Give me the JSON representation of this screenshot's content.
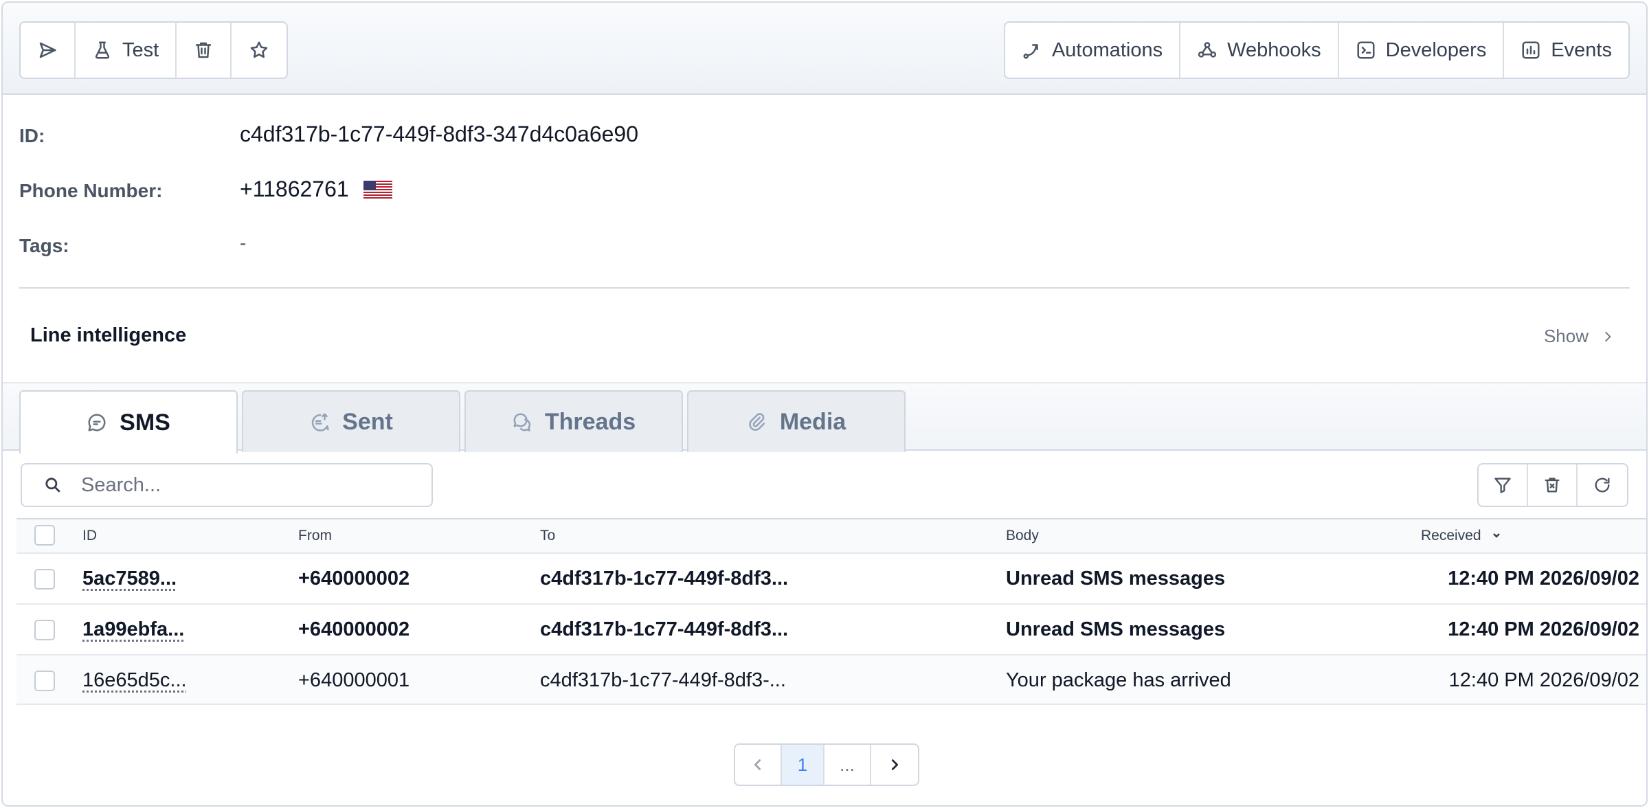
{
  "toolbar": {
    "left_buttons": [
      {
        "icon": "send-icon",
        "label": ""
      },
      {
        "icon": "flask-icon",
        "label": "Test"
      },
      {
        "icon": "trash-icon",
        "label": ""
      },
      {
        "icon": "star-icon",
        "label": ""
      }
    ],
    "right_buttons": [
      {
        "icon": "automation-icon",
        "label": "Automations"
      },
      {
        "icon": "webhook-icon",
        "label": "Webhooks"
      },
      {
        "icon": "terminal-icon",
        "label": "Developers"
      },
      {
        "icon": "bar-chart-icon",
        "label": "Events"
      }
    ]
  },
  "details": {
    "id_label": "ID:",
    "id_value": "c4df317b-1c77-449f-8df3-347d4c0a6e90",
    "phone_label": "Phone Number:",
    "phone_value": "+11862761",
    "phone_flag": "us-flag-icon",
    "tags_label": "Tags:",
    "tags_value": "-"
  },
  "line_intelligence": {
    "title": "Line intelligence",
    "toggle_label": "Show"
  },
  "tabs": [
    {
      "label": "SMS",
      "icon": "chat-bubble-icon",
      "active": true
    },
    {
      "label": "Sent",
      "icon": "chat-upload-icon",
      "active": false
    },
    {
      "label": "Threads",
      "icon": "chat-bubbles-icon",
      "active": false
    },
    {
      "label": "Media",
      "icon": "paperclip-icon",
      "active": false
    }
  ],
  "search": {
    "placeholder": "Search...",
    "value": ""
  },
  "table": {
    "columns": [
      "ID",
      "From",
      "To",
      "Body",
      "Received"
    ],
    "sorted_column": "Received",
    "rows": [
      {
        "id": "5ac7589...",
        "from": "+640000002",
        "to": "c4df317b-1c77-449f-8df3...",
        "body": "Unread SMS messages",
        "received": "12:40 PM 2026/09/02",
        "unread": true
      },
      {
        "id": "1a99ebfa...",
        "from": "+640000002",
        "to": "c4df317b-1c77-449f-8df3...",
        "body": "Unread SMS messages",
        "received": "12:40 PM 2026/09/02",
        "unread": true
      },
      {
        "id": "16e65d5c...",
        "from": "+640000001",
        "to": "c4df317b-1c77-449f-8df3-...",
        "body": "Your package has arrived",
        "received": "12:40 PM 2026/09/02",
        "unread": false
      }
    ]
  },
  "pagination": {
    "current_page": "1",
    "ellipsis": "..."
  },
  "colors": {
    "accent": "#3b82f6",
    "border": "#d4dae3",
    "toolbar_bg": "#eef2f7"
  }
}
